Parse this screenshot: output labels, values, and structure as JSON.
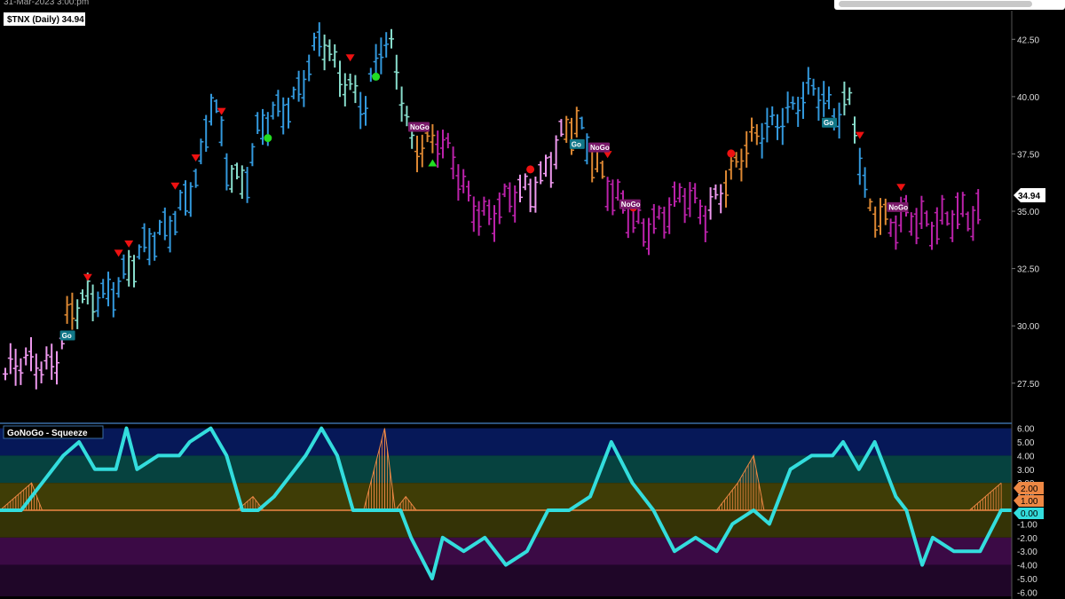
{
  "header": {
    "timestamp": "31-Mar-2023 3:00:pm"
  },
  "colors": {
    "strong_go": "#3399dd",
    "go": "#88ddcc",
    "nogo": "#bb22aa",
    "strong_nogo": "#ee99ee",
    "neutral": "#dd8833",
    "red": "#ee1111",
    "green": "#22dd22",
    "squeeze": "#33dddd",
    "zero_line": "#ee8844",
    "go_label": "#117788",
    "nogo_label": "#7a1a6a"
  },
  "chart_data": [
    {
      "type": "ohlc",
      "title": "$TNX (Daily) 34.94",
      "last_price": "34.94",
      "ylim": [
        25.75,
        43.75
      ],
      "yticks": [
        "42.50",
        "40.00",
        "37.50",
        "35.00",
        "32.50",
        "30.00",
        "27.50"
      ],
      "bar_count": 190,
      "series": {
        "colors": [
          {
            "from": 0,
            "to": 11,
            "color": "strong_nogo"
          },
          {
            "from": 12,
            "to": 13,
            "color": "neutral"
          },
          {
            "from": 14,
            "to": 17,
            "color": "go"
          },
          {
            "from": 18,
            "to": 23,
            "color": "strong_go"
          },
          {
            "from": 24,
            "to": 25,
            "color": "go"
          },
          {
            "from": 26,
            "to": 43,
            "color": "strong_go"
          },
          {
            "from": 44,
            "to": 46,
            "color": "go"
          },
          {
            "from": 47,
            "to": 61,
            "color": "strong_go"
          },
          {
            "from": 62,
            "to": 68,
            "color": "go"
          },
          {
            "from": 69,
            "to": 74,
            "color": "strong_go"
          },
          {
            "from": 75,
            "to": 79,
            "color": "go"
          },
          {
            "from": 80,
            "to": 83,
            "color": "neutral"
          },
          {
            "from": 84,
            "to": 99,
            "color": "nogo"
          },
          {
            "from": 100,
            "to": 108,
            "color": "strong_nogo"
          },
          {
            "from": 109,
            "to": 111,
            "color": "neutral"
          },
          {
            "from": 112,
            "to": 113,
            "color": "strong_go"
          },
          {
            "from": 114,
            "to": 116,
            "color": "neutral"
          },
          {
            "from": 117,
            "to": 136,
            "color": "nogo"
          },
          {
            "from": 137,
            "to": 139,
            "color": "strong_nogo"
          },
          {
            "from": 140,
            "to": 146,
            "color": "neutral"
          },
          {
            "from": 147,
            "to": 162,
            "color": "strong_go"
          },
          {
            "from": 163,
            "to": 165,
            "color": "go"
          },
          {
            "from": 166,
            "to": 167,
            "color": "strong_go"
          },
          {
            "from": 168,
            "to": 171,
            "color": "neutral"
          },
          {
            "from": 172,
            "to": 189,
            "color": "nogo"
          }
        ],
        "close_path": [
          [
            0,
            27.9
          ],
          [
            11,
            28.6
          ],
          [
            14,
            30.4
          ],
          [
            22,
            31.5
          ],
          [
            30,
            32.9
          ],
          [
            43,
            36.4
          ],
          [
            46,
            40.0
          ],
          [
            49,
            37.3
          ],
          [
            53,
            36.2
          ],
          [
            56,
            38.2
          ],
          [
            64,
            40.1
          ],
          [
            70,
            42.4
          ],
          [
            73,
            41.2
          ],
          [
            78,
            40.3
          ],
          [
            80,
            39.7
          ],
          [
            83,
            42.0
          ],
          [
            86,
            41.8
          ],
          [
            90,
            38.2
          ],
          [
            96,
            38.0
          ],
          [
            99,
            37.1
          ],
          [
            103,
            35.6
          ],
          [
            108,
            34.8
          ],
          [
            113,
            35.5
          ],
          [
            118,
            36.4
          ],
          [
            124,
            38.2
          ],
          [
            127,
            38.6
          ],
          [
            131,
            37.4
          ],
          [
            136,
            35.4
          ],
          [
            141,
            34.0
          ],
          [
            146,
            35.1
          ],
          [
            150,
            35.6
          ],
          [
            155,
            34.7
          ],
          [
            160,
            36.6
          ],
          [
            166,
            37.9
          ],
          [
            172,
            39.3
          ],
          [
            179,
            40.1
          ],
          [
            184,
            39.3
          ],
          [
            187,
            40.2
          ],
          [
            189,
            38.6
          ],
          [
            190,
            36.2
          ],
          [
            192,
            34.8
          ],
          [
            196,
            34.3
          ],
          [
            200,
            35.2
          ],
          [
            206,
            34.0
          ],
          [
            212,
            35.2
          ],
          [
            217,
            34.9
          ]
        ]
      },
      "go_labels": [
        {
          "bar": 12,
          "label": "Go"
        },
        {
          "bar": 111,
          "label": "Go"
        },
        {
          "bar": 160,
          "label": "Go"
        }
      ],
      "nogo_labels": [
        {
          "bar": 80,
          "label": "NoGo"
        },
        {
          "bar": 115,
          "label": "NoGo"
        },
        {
          "bar": 121,
          "label": "NoGo"
        },
        {
          "bar": 173,
          "label": "NoGo"
        }
      ],
      "down_triangles": [
        16,
        22,
        24,
        33,
        37,
        42,
        67,
        117,
        166,
        174
      ],
      "up_triangles": [
        83
      ],
      "green_dots": [
        51,
        72
      ],
      "red_dots": [
        102,
        122,
        141
      ]
    },
    {
      "type": "line",
      "title": "GoNoGo - Squeeze",
      "ylim": [
        -6.3,
        6.3
      ],
      "yticks": [
        "6.00",
        "5.00",
        "4.00",
        "3.00",
        "2.00",
        "1.00",
        "0.00",
        "-1.00",
        "-2.00",
        "-3.00",
        "-4.00",
        "-5.00",
        "-6.00"
      ],
      "value_labels": [
        "2.00",
        "1.00",
        "0.00"
      ],
      "bands": [
        {
          "from": 4,
          "to": 6,
          "color": "#061858"
        },
        {
          "from": 2,
          "to": 4,
          "color": "#06423f"
        },
        {
          "from": 0,
          "to": 2,
          "color": "#3f3d06"
        },
        {
          "from": -2,
          "to": 0,
          "color": "#343306"
        },
        {
          "from": -4,
          "to": -2,
          "color": "#3b0a45"
        },
        {
          "from": -6.3,
          "to": -4,
          "color": "#1f0628"
        }
      ],
      "oscillator": [
        [
          0,
          0
        ],
        [
          4,
          0
        ],
        [
          8,
          2
        ],
        [
          12,
          4
        ],
        [
          15,
          5
        ],
        [
          18,
          3
        ],
        [
          22,
          3
        ],
        [
          24,
          6
        ],
        [
          26,
          3
        ],
        [
          30,
          4
        ],
        [
          34,
          4
        ],
        [
          36,
          5
        ],
        [
          40,
          6
        ],
        [
          43,
          4
        ],
        [
          46,
          0
        ],
        [
          49,
          0
        ],
        [
          52,
          1
        ],
        [
          58,
          4
        ],
        [
          61,
          6
        ],
        [
          64,
          4
        ],
        [
          67,
          0
        ],
        [
          74,
          0
        ],
        [
          76,
          0
        ],
        [
          78,
          -2
        ],
        [
          82,
          -5
        ],
        [
          84,
          -2
        ],
        [
          88,
          -3
        ],
        [
          92,
          -2
        ],
        [
          96,
          -4
        ],
        [
          100,
          -3
        ],
        [
          104,
          0
        ],
        [
          108,
          0
        ],
        [
          112,
          1
        ],
        [
          116,
          5
        ],
        [
          120,
          2
        ],
        [
          124,
          0
        ],
        [
          128,
          -3
        ],
        [
          132,
          -2
        ],
        [
          136,
          -3
        ],
        [
          139,
          -1
        ],
        [
          143,
          0
        ],
        [
          146,
          -1
        ],
        [
          150,
          3
        ],
        [
          154,
          4
        ],
        [
          158,
          4
        ],
        [
          160,
          5
        ],
        [
          163,
          3
        ],
        [
          166,
          5
        ],
        [
          170,
          1
        ],
        [
          172,
          0
        ],
        [
          175,
          -4
        ],
        [
          177,
          -2
        ],
        [
          181,
          -3
        ],
        [
          186,
          -3
        ],
        [
          190,
          0
        ],
        [
          192,
          0
        ]
      ],
      "squeeze": [
        [
          0,
          0
        ],
        [
          3,
          1
        ],
        [
          6,
          2
        ],
        [
          8,
          0
        ],
        [
          45,
          0
        ],
        [
          48,
          1
        ],
        [
          50,
          0
        ],
        [
          69,
          0
        ],
        [
          71,
          3
        ],
        [
          73,
          6
        ],
        [
          75,
          0
        ],
        [
          77,
          1
        ],
        [
          79,
          0
        ],
        [
          136,
          0
        ],
        [
          140,
          2
        ],
        [
          143,
          4
        ],
        [
          145,
          0
        ],
        [
          184,
          0
        ],
        [
          187,
          1
        ],
        [
          190,
          2
        ]
      ]
    }
  ]
}
